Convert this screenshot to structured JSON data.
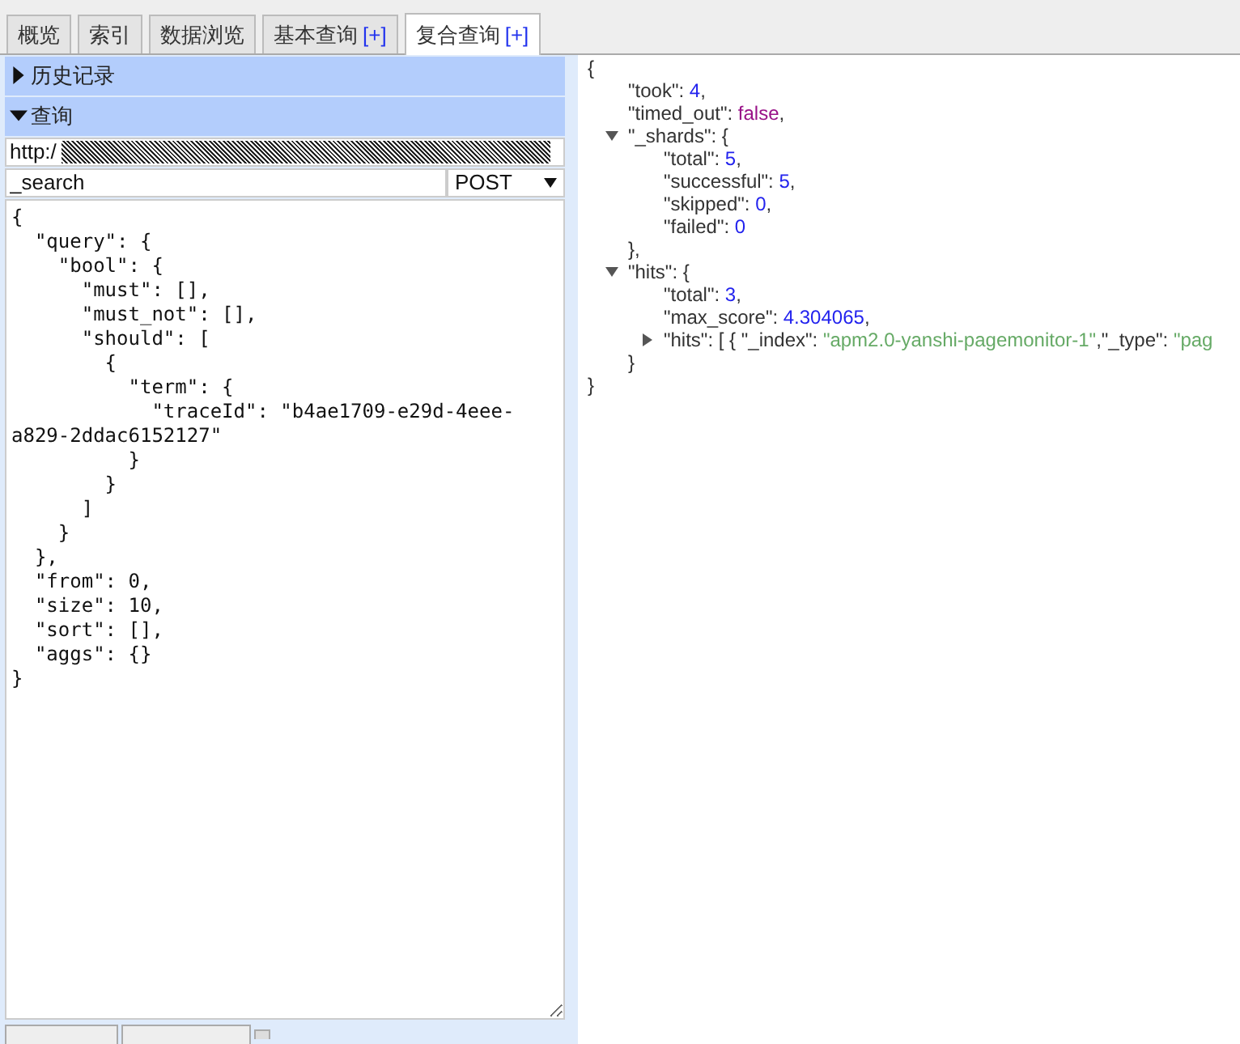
{
  "tabs": [
    {
      "label": "概览",
      "selected": false
    },
    {
      "label": "索引",
      "selected": false
    },
    {
      "label": "数据浏览",
      "selected": false
    },
    {
      "label": "基本查询",
      "plus": "[+]",
      "selected": false
    },
    {
      "label": "复合查询",
      "plus": "[+]",
      "selected": true
    }
  ],
  "sections": [
    {
      "title": "历史记录",
      "expanded": false
    },
    {
      "title": "查询",
      "expanded": true
    }
  ],
  "query": {
    "url": "http:/",
    "path": "_search",
    "method": "POST",
    "body": "{\n  \"query\": {\n    \"bool\": {\n      \"must\": [],\n      \"must_not\": [],\n      \"should\": [\n        {\n          \"term\": {\n            \"traceId\": \"b4ae1709-e29d-4eee-a829-2ddac6152127\"\n          }\n        }\n      ]\n    }\n  },\n  \"from\": 0,\n  \"size\": 10,\n  \"sort\": [],\n  \"aggs\": {}\n}"
  },
  "response": {
    "open": "{",
    "close": "}",
    "children": [
      {
        "kind": "number",
        "key": "\"took\": ",
        "value": "4",
        "tail": ","
      },
      {
        "kind": "boolean",
        "key": "\"timed_out\": ",
        "value": "false",
        "tail": ","
      },
      {
        "kind": "object",
        "key": "\"_shards\": ",
        "open": "{",
        "close": "},",
        "expanded": true,
        "children": [
          {
            "kind": "number",
            "key": "\"total\": ",
            "value": "5",
            "tail": ","
          },
          {
            "kind": "number",
            "key": "\"successful\": ",
            "value": "5",
            "tail": ","
          },
          {
            "kind": "number",
            "key": "\"skipped\": ",
            "value": "0",
            "tail": ","
          },
          {
            "kind": "number",
            "key": "\"failed\": ",
            "value": "0"
          }
        ]
      },
      {
        "kind": "object",
        "key": "\"hits\": ",
        "open": "{",
        "close": "}",
        "expanded": true,
        "children": [
          {
            "kind": "number",
            "key": "\"total\": ",
            "value": "3",
            "tail": ","
          },
          {
            "kind": "number",
            "key": "\"max_score\": ",
            "value": "4.304065",
            "tail": ","
          },
          {
            "kind": "object",
            "key": "\"hits\": ",
            "open": "[ { ",
            "expanded": false,
            "preview": [
              {
                "kind": "key",
                "text": "\"_index\": "
              },
              {
                "kind": "string",
                "text": "\"apm2.0-yanshi-pagemonitor-1\""
              },
              {
                "kind": "key",
                "text": ",\"_type\": "
              },
              {
                "kind": "string",
                "text": "\"pag"
              }
            ]
          }
        ]
      }
    ]
  }
}
